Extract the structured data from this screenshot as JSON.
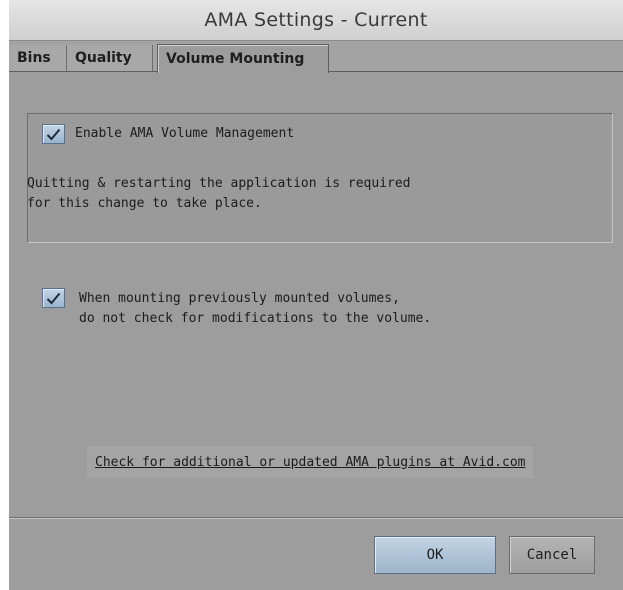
{
  "window": {
    "title": "AMA Settings - Current"
  },
  "tabs": [
    {
      "label": "Bins",
      "active": false
    },
    {
      "label": "Quality",
      "active": false
    },
    {
      "label": "Volume Mounting",
      "active": true
    }
  ],
  "volume_management": {
    "label": "Enable AMA Volume Management",
    "checked": true,
    "note_line1": "Quitting & restarting the application is required",
    "note_line2": "for this change to take place."
  },
  "mounting_option": {
    "label_line1": "When mounting previously mounted volumes,",
    "label_line2": "do not check for modifications to the volume.",
    "checked": true
  },
  "plugins_link": {
    "label": "Check for additional or updated AMA plugins at Avid.com"
  },
  "buttons": {
    "ok": "OK",
    "cancel": "Cancel"
  },
  "icons": {
    "checkbox_mark": "checkmark-icon"
  },
  "colors": {
    "window_bg": "#9d9d9d",
    "checkbox_fill": "#a9c0d8",
    "ok_button": "#b0c4d8"
  }
}
